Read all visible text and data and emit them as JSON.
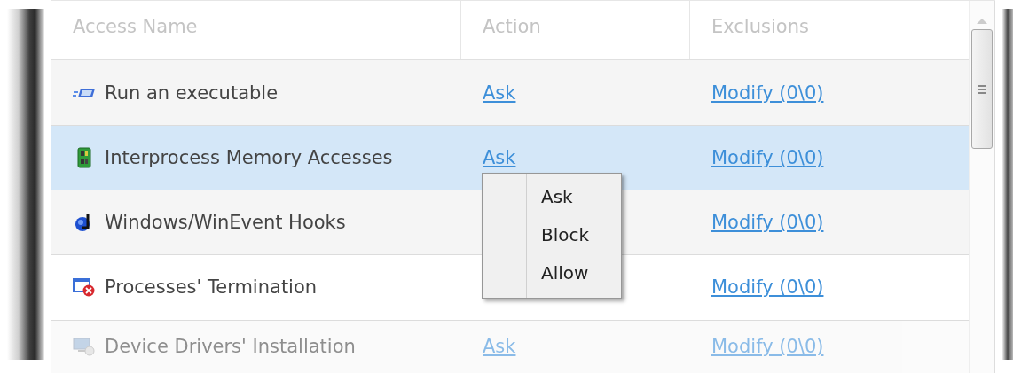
{
  "table": {
    "columns": [
      "Access Name",
      "Action",
      "Exclusions"
    ],
    "rows": [
      {
        "kind": "run",
        "name": "Run an executable",
        "action": "Ask",
        "exclusions": "Modify (0\\0)",
        "selected": false
      },
      {
        "kind": "memory",
        "name": "Interprocess Memory Accesses",
        "action": "Ask",
        "exclusions": "Modify (0\\0)",
        "selected": true
      },
      {
        "kind": "hooks",
        "name": "Windows/WinEvent Hooks",
        "exclusions": "Modify (0\\0)",
        "selected": false
      },
      {
        "kind": "terminate",
        "name": "Processes' Termination",
        "exclusions": "Modify (0\\0)",
        "selected": false
      },
      {
        "kind": "driver",
        "name": "Device Drivers' Installation",
        "action": "Ask",
        "exclusions": "Modify (0\\0)",
        "selected": false
      }
    ]
  },
  "context_menu": {
    "items": [
      "Ask",
      "Block",
      "Allow"
    ]
  }
}
